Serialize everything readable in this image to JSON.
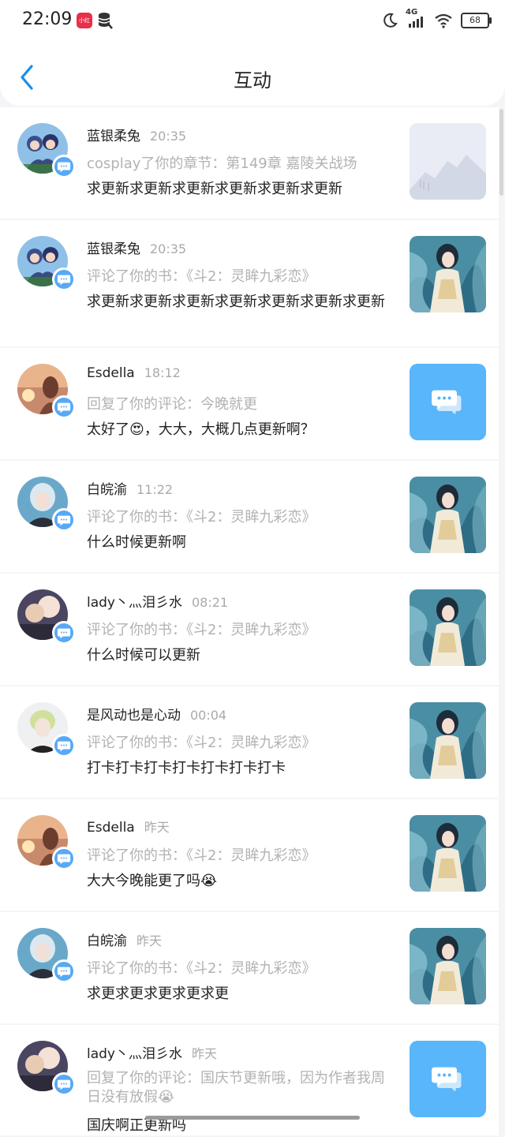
{
  "status_bar": {
    "time": "22:09",
    "app_icon_text": "小红书",
    "network": "4G",
    "battery": "68"
  },
  "header": {
    "title": "互动",
    "back_icon": "chevron-left-icon"
  },
  "colors": {
    "accent": "#57a9f5",
    "background": "#f4f5f7",
    "muted_text": "#b2b2b2"
  },
  "notifications": [
    {
      "name": "蓝银柔兔",
      "time": "20:35",
      "action": "cosplay了你的章节：第149章 嘉陵关战场",
      "comment": "求更新求更新求更新求更新求更新求更新",
      "thumb": "placeholder-mountain"
    },
    {
      "name": "蓝银柔兔",
      "time": "20:35",
      "action": "评论了你的书：《斗2：灵眸九彩恋》",
      "comment": "求更新求更新求更新求更新求更新求更新求更新",
      "thumb": "book-cover"
    },
    {
      "name": "Esdella",
      "time": "18:12",
      "action": "回复了你的评论：今晚就更",
      "comment": "太好了😍，大大，大概几点更新啊？",
      "thumb": "chat-bubble"
    },
    {
      "name": "白皖渝",
      "time": "11:22",
      "action": "评论了你的书：《斗2：灵眸九彩恋》",
      "comment": "什么时候更新啊",
      "thumb": "book-cover"
    },
    {
      "name": "lady丶灬泪彡水",
      "time": "08:21",
      "action": "评论了你的书：《斗2：灵眸九彩恋》",
      "comment": "什么时候可以更新",
      "thumb": "book-cover"
    },
    {
      "name": "是风动也是心动",
      "time": "00:04",
      "action": "评论了你的书：《斗2：灵眸九彩恋》",
      "comment": "打卡打卡打卡打卡打卡打卡打卡",
      "thumb": "book-cover"
    },
    {
      "name": "Esdella",
      "time": "昨天",
      "action": "评论了你的书：《斗2：灵眸九彩恋》",
      "comment": "大大今晚能更了吗😭",
      "thumb": "book-cover"
    },
    {
      "name": "白皖渝",
      "time": "昨天",
      "action": "评论了你的书：《斗2：灵眸九彩恋》",
      "comment": "求更求更求更求更求更",
      "thumb": "book-cover"
    },
    {
      "name": "lady丶灬泪彡水",
      "time": "昨天",
      "action": "回复了你的评论：国庆节更新哦，因为作者我周日没有放假😭",
      "comment": "国庆啊正更新吗",
      "thumb": "chat-bubble"
    }
  ]
}
